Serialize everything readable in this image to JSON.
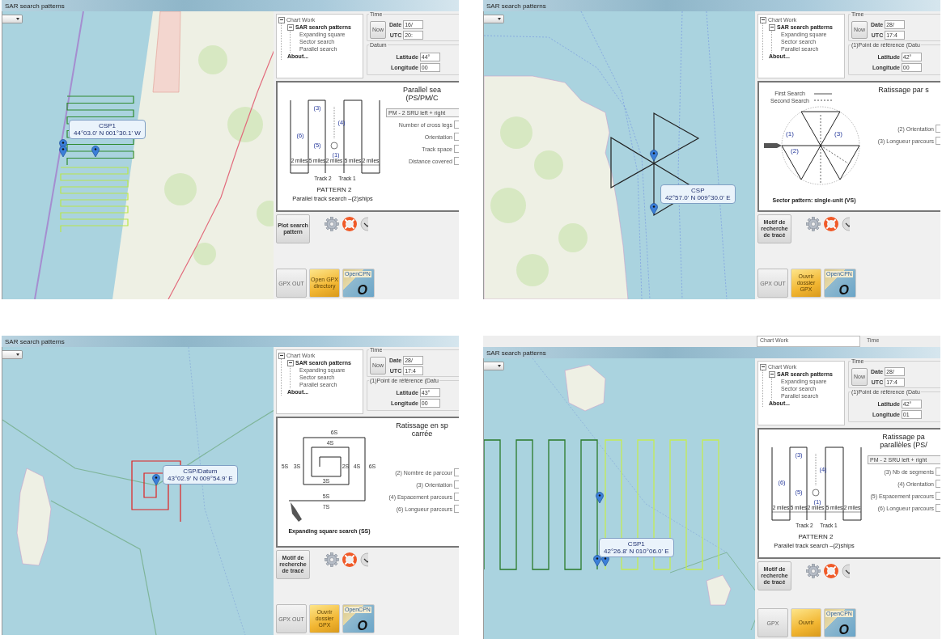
{
  "quadrants": [
    {
      "title": "SAR search patterns",
      "map": {
        "kind": "parallel",
        "callout": {
          "name": "CSP1",
          "coords": "44°03.0' N 001°30.1' W"
        }
      },
      "tree": {
        "label": "Chart Work",
        "expanded": true,
        "children": [
          {
            "label": "SAR search patterns",
            "expanded": true,
            "children": [
              {
                "label": "Expanding square"
              },
              {
                "label": "Sector search"
              },
              {
                "label": "Parallel search"
              }
            ]
          },
          {
            "label": "About..."
          }
        ]
      },
      "time": {
        "legend": "Time",
        "now": "Now",
        "date_label": "Date",
        "date": "16/",
        "utc_label": "UTC",
        "utc": "20:"
      },
      "datum": {
        "legend": "Datum",
        "lat_label": "Latitude",
        "lat": "44°",
        "lon_label": "Longitude",
        "lon": "00"
      },
      "diagram": {
        "kind": "parallel",
        "labels": [
          "(3)",
          "(4)",
          "(6)",
          "(5)",
          "(1)",
          "2 miles",
          "5 miles",
          "2 miles",
          "5 miles",
          "2 miles",
          "Track 2",
          "Track 1"
        ],
        "caption_title": "PATTERN 2",
        "caption": "Parallel track search –(2)ships"
      },
      "form": {
        "title": [
          "Parallel sea",
          "(PS/PM/C"
        ],
        "dropdown": "PM - 2 SRU left + right",
        "fields": [
          "Number of cross legs",
          "Orientation",
          "Track space",
          "Distance covered"
        ]
      },
      "plot_button": "Plot search pattern",
      "gpx_button": "GPX OUT",
      "folder_button": "Open GPX directory",
      "opencpn": {
        "label": "OpenCPN",
        "mark": "O"
      }
    },
    {
      "title": "SAR search patterns",
      "map": {
        "kind": "sector",
        "callout": {
          "name": "CSP",
          "coords": "42°57.0' N 009°30.0' E"
        }
      },
      "tree": {
        "label": "Chart Work",
        "expanded": true,
        "children": [
          {
            "label": "SAR search patterns",
            "expanded": true,
            "children": [
              {
                "label": "Expanding square"
              },
              {
                "label": "Sector search"
              },
              {
                "label": "Parallel search"
              }
            ]
          },
          {
            "label": "About..."
          }
        ]
      },
      "time": {
        "legend": "Time",
        "now": "Now",
        "date_label": "Date",
        "date": "28/",
        "utc_label": "UTC",
        "utc": "17:4"
      },
      "datum": {
        "legend": "(1)Point de référence (Datu",
        "lat_label": "Latitude",
        "lat": "42°",
        "lon_label": "Longitude",
        "lon": "00"
      },
      "diagram": {
        "kind": "sector",
        "labels": [
          "First Search",
          "Second Search",
          "(1)",
          "(2)",
          "(3)"
        ],
        "caption": "Sector pattern: single-unit (VS)"
      },
      "form": {
        "title": [
          "Ratissage par s"
        ],
        "fields": [
          "(2) Orientation",
          "(3) Longueur parcours"
        ]
      },
      "plot_button": "Motif de recherche de tracé",
      "gpx_button": "GPX OUT",
      "folder_button": "Ouvrir dossier GPX",
      "opencpn": {
        "label": "OpenCPN",
        "mark": "O"
      }
    },
    {
      "title": "SAR search patterns",
      "map": {
        "kind": "square",
        "callout": {
          "name": "CSP/Datum",
          "coords": "43°02.9' N 009°54.9' E"
        }
      },
      "tree": {
        "label": "Chart Work",
        "expanded": true,
        "children": [
          {
            "label": "SAR search patterns",
            "expanded": true,
            "children": [
              {
                "label": "Expanding square"
              },
              {
                "label": "Sector search"
              },
              {
                "label": "Parallel search"
              }
            ]
          },
          {
            "label": "About..."
          }
        ]
      },
      "time": {
        "legend": "Time",
        "now": "Now",
        "date_label": "Date",
        "date": "28/",
        "utc_label": "UTC",
        "utc": "17:4"
      },
      "datum": {
        "legend": "(1)Point de référence (Datu",
        "lat_label": "Latitude",
        "lat": "43°",
        "lon_label": "Longitude",
        "lon": "00"
      },
      "diagram": {
        "kind": "square",
        "labels": [
          "6S",
          "4S",
          "5S",
          "3S",
          "2S",
          "4S",
          "6S",
          "3S",
          "5S",
          "7S"
        ],
        "caption": "Expanding square search (SS)"
      },
      "form": {
        "title": [
          "Ratissage en sp",
          "carrée"
        ],
        "fields": [
          "(2) Nombre de parcour",
          "(3) Orientation",
          "(4) Espacement parcours",
          "(6) Longueur parcours"
        ]
      },
      "plot_button": "Motif de recherche de tracé",
      "gpx_button": "GPX OUT",
      "folder_button": "Ouvrir dossier GPX",
      "opencpn": {
        "label": "OpenCPN",
        "mark": "O"
      }
    },
    {
      "title": "SAR search patterns",
      "behind": {
        "tree_label": "Chart Work",
        "time_legend": "Time"
      },
      "map": {
        "kind": "parallel2",
        "callout": {
          "name": "CSP1",
          "coords": "42°26.8' N 010°06.0' E"
        }
      },
      "tree": {
        "label": "Chart Work",
        "expanded": true,
        "children": [
          {
            "label": "SAR search patterns",
            "expanded": true,
            "children": [
              {
                "label": "Expanding square"
              },
              {
                "label": "Sector search"
              },
              {
                "label": "Parallel search"
              }
            ]
          },
          {
            "label": "About..."
          }
        ]
      },
      "time": {
        "legend": "Time",
        "now": "Now",
        "date_label": "Date",
        "date": "28/",
        "utc_label": "UTC",
        "utc": "17:4"
      },
      "datum": {
        "legend": "(1)Point de référence (Datu",
        "lat_label": "Latitude",
        "lat": "42°",
        "lon_label": "Longitude",
        "lon": "01"
      },
      "diagram": {
        "kind": "parallel",
        "labels": [
          "(3)",
          "(4)",
          "(6)",
          "(5)",
          "(1)",
          "2 miles",
          "5 miles",
          "2 miles",
          "5 miles",
          "2 miles",
          "Track 2",
          "Track 1"
        ],
        "caption_title": "PATTERN 2",
        "caption": "Parallel track search –(2)ships"
      },
      "form": {
        "title": [
          "Ratissage pa",
          "parallèles (PS/"
        ],
        "dropdown": "PM - 2 SRU left + right",
        "fields": [
          "(3) Nb de segments",
          "(4) Orientation",
          "(5) Espacement parcours",
          "(6) Longueur parcours"
        ]
      },
      "plot_button": "Motif de recherche de tracé",
      "gpx_button": "GPX",
      "folder_button": "Ouvrir",
      "opencpn": {
        "label": "OpenCPN",
        "mark": "O"
      }
    }
  ]
}
